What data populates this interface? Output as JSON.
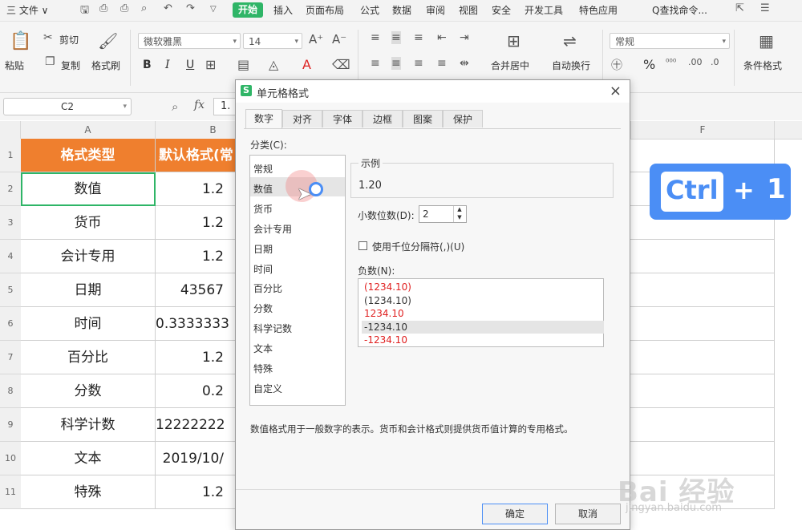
{
  "menubar": {
    "file": "三 文件 ∨",
    "tabs": [
      "开始",
      "插入",
      "页面布局",
      "公式",
      "数据",
      "审阅",
      "视图",
      "安全",
      "开发工具",
      "特色应用"
    ],
    "search": "Q查找命令..."
  },
  "ribbon": {
    "paste": "粘贴",
    "cut": "剪切",
    "copy": "复制",
    "format_painter": "格式刷",
    "font_name": "微软雅黑",
    "font_size": "14",
    "bold": "B",
    "italic": "I",
    "underline": "U",
    "merge_center": "合并居中",
    "wrap_text": "自动换行",
    "number_format": "常规",
    "percent": "%",
    "conditional_format": "条件格式"
  },
  "formula": {
    "namebox": "C2",
    "fx": "fx",
    "value": "1."
  },
  "sheet": {
    "columns": [
      "A",
      "B",
      "F"
    ],
    "rows": [
      "1",
      "2",
      "3",
      "4",
      "5",
      "6",
      "7",
      "8",
      "9",
      "10",
      "11"
    ],
    "header": [
      "格式类型",
      "默认格式(常"
    ],
    "data": [
      [
        "数值",
        "1.2"
      ],
      [
        "货币",
        "1.2"
      ],
      [
        "会计专用",
        "1.2"
      ],
      [
        "日期",
        "43567"
      ],
      [
        "时间",
        "0.3333333"
      ],
      [
        "百分比",
        "1.2"
      ],
      [
        "分数",
        "0.2"
      ],
      [
        "科学计数",
        "12222222"
      ],
      [
        "文本",
        "2019/10/"
      ],
      [
        "特殊",
        "1.2"
      ]
    ]
  },
  "dialog": {
    "title": "单元格格式",
    "close": "×",
    "tabs": [
      "数字",
      "对齐",
      "字体",
      "边框",
      "图案",
      "保护"
    ],
    "category_label": "分类(C):",
    "categories": [
      "常规",
      "数值",
      "货币",
      "会计专用",
      "日期",
      "时间",
      "百分比",
      "分数",
      "科学记数",
      "文本",
      "特殊",
      "自定义"
    ],
    "sample_label": "示例",
    "sample_value": "1.20",
    "decimal_label": "小数位数(D):",
    "decimal_value": "2",
    "thousands_label": "使用千位分隔符(,)(U)",
    "negative_label": "负数(N):",
    "negatives": [
      "(1234.10)",
      "(1234.10)",
      "1234.10",
      "-1234.10",
      "-1234.10"
    ],
    "negative_colors": [
      "#e02020",
      "#333333",
      "#e02020",
      "#333333",
      "#e02020"
    ],
    "description": "数值格式用于一般数字的表示。货币和会计格式则提供货币值计算的专用格式。",
    "ok": "确定",
    "cancel": "取消"
  },
  "shortcut": {
    "key": "Ctrl",
    "plus": "+",
    "num": "1"
  },
  "watermark": {
    "brand": "Bai  经验",
    "url": "jingyan.baidu.com"
  },
  "colors": {
    "accent_green": "#2fb567",
    "header_orange": "#ef7f2e",
    "badge_blue": "#4b8ef5",
    "negative_red": "#e02020"
  }
}
